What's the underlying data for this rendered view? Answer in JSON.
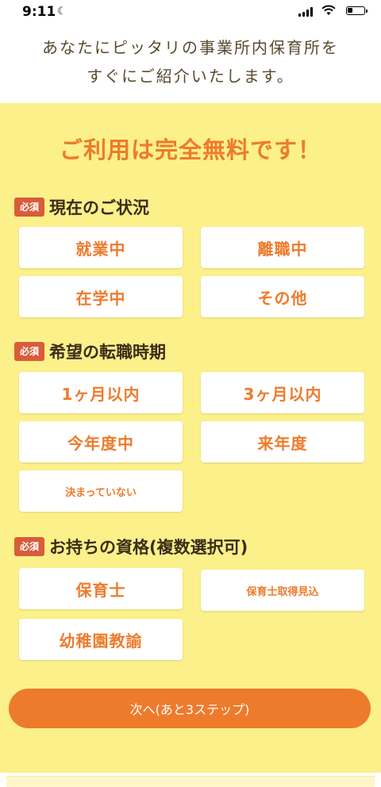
{
  "status": {
    "time": "9:11"
  },
  "intro": {
    "line1": "あなたにピッタリの事業所内保育所を",
    "line2": "すぐにご紹介いたします。"
  },
  "headline": "ご利用は完全無料です！",
  "required_badge": "必須",
  "sections": [
    {
      "title": "現在のご状況",
      "options": [
        "就業中",
        "離職中",
        "在学中",
        "その他"
      ]
    },
    {
      "title": "希望の転職時期",
      "options": [
        "1ヶ月以内",
        "3ヶ月以内",
        "今年度中",
        "来年度",
        "決まっていない"
      ]
    },
    {
      "title": "お持ちの資格(複数選択可)",
      "options": [
        "保育士",
        "保育士取得見込",
        "幼稚園教諭"
      ]
    }
  ],
  "next_button": "次へ(あと3ステップ)",
  "colors": {
    "accent": "#ee7b2b",
    "panel": "#fcf08a",
    "badge": "#d85c3a",
    "text": "#3b2d18"
  },
  "icons": [
    "moon-icon",
    "signal-icon",
    "wifi-icon",
    "battery-icon"
  ]
}
